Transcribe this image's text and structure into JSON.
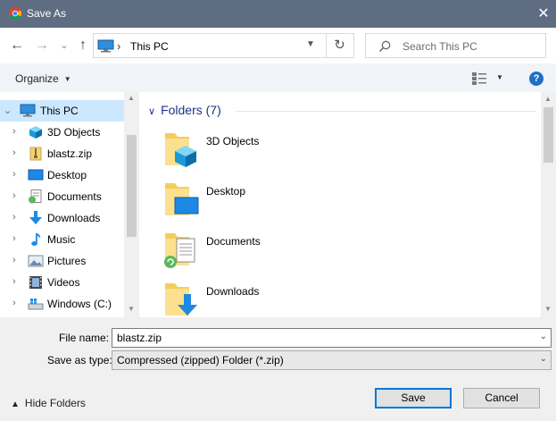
{
  "window": {
    "title": "Save As",
    "close_glyph": "✕"
  },
  "toolbar": {
    "back_glyph": "←",
    "forward_glyph": "→",
    "recent_glyph": "⌄",
    "up_glyph": "↑",
    "breadcrumb_separator": "›",
    "address_path": "This PC",
    "refresh_glyph": "↻",
    "search_placeholder": "Search This PC"
  },
  "commandbar": {
    "organize_label": "Organize",
    "help_glyph": "?"
  },
  "nav": {
    "items": [
      {
        "label": "This PC",
        "icon": "this-pc-icon",
        "selected": true
      },
      {
        "label": "3D Objects",
        "icon": "3d-objects-icon"
      },
      {
        "label": "blastz.zip",
        "icon": "zip-folder-icon"
      },
      {
        "label": "Desktop",
        "icon": "desktop-icon"
      },
      {
        "label": "Documents",
        "icon": "documents-icon"
      },
      {
        "label": "Downloads",
        "icon": "downloads-icon"
      },
      {
        "label": "Music",
        "icon": "music-icon"
      },
      {
        "label": "Pictures",
        "icon": "pictures-icon"
      },
      {
        "label": "Videos",
        "icon": "videos-icon"
      },
      {
        "label": "Windows (C:)",
        "icon": "drive-icon"
      }
    ]
  },
  "content": {
    "group_title": "Folders (7)",
    "folders": [
      {
        "label": "3D Objects",
        "icon": "3d-objects-folder-icon"
      },
      {
        "label": "Desktop",
        "icon": "desktop-folder-icon"
      },
      {
        "label": "Documents",
        "icon": "documents-folder-icon"
      },
      {
        "label": "Downloads",
        "icon": "downloads-folder-icon"
      }
    ]
  },
  "form": {
    "file_name_label": "File name:",
    "file_name_value": "blastz.zip",
    "save_type_label": "Save as type:",
    "save_type_value": "Compressed (zipped) Folder (*.zip)",
    "hide_folders_label": "Hide Folders",
    "save_label": "Save",
    "cancel_label": "Cancel"
  },
  "colors": {
    "titlebar": "#5e6d82",
    "selection": "#cce8ff",
    "accent": "#0078d7",
    "group_title": "#1e3287"
  }
}
